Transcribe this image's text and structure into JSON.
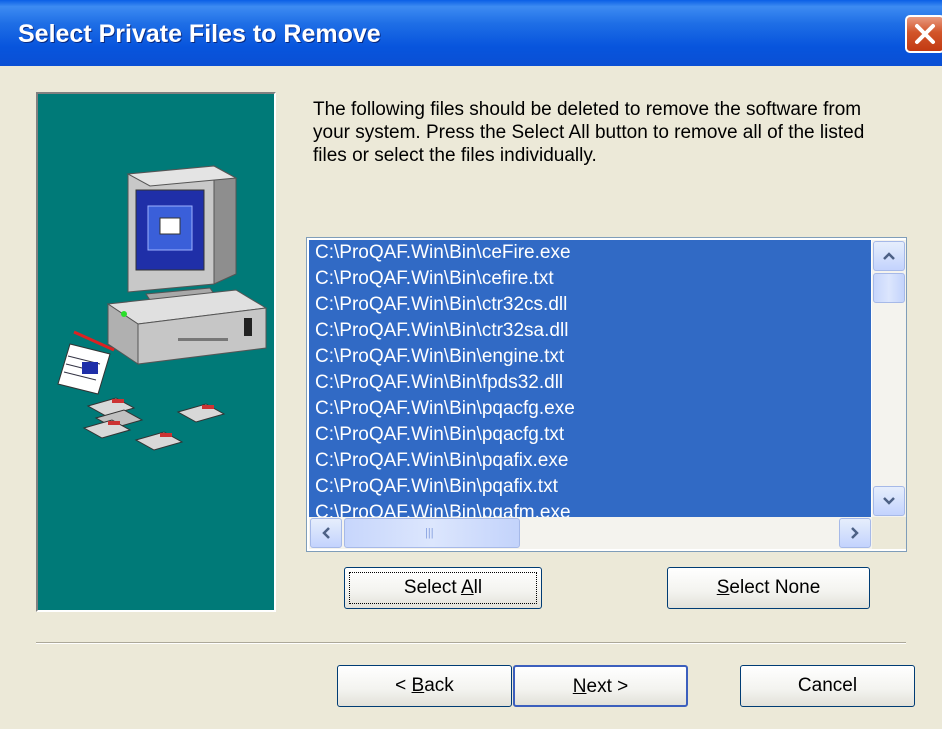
{
  "window": {
    "title": "Select Private Files to Remove"
  },
  "instructions": "The following files should be deleted to remove the software from your system.  Press the Select All button to remove all of the listed files or select the files individually.",
  "file_list": {
    "items": [
      "C:\\ProQAF.Win\\Bin\\ceFire.exe",
      "C:\\ProQAF.Win\\Bin\\cefire.txt",
      "C:\\ProQAF.Win\\Bin\\ctr32cs.dll",
      "C:\\ProQAF.Win\\Bin\\ctr32sa.dll",
      "C:\\ProQAF.Win\\Bin\\engine.txt",
      "C:\\ProQAF.Win\\Bin\\fpds32.dll",
      "C:\\ProQAF.Win\\Bin\\pqacfg.exe",
      "C:\\ProQAF.Win\\Bin\\pqacfg.txt",
      "C:\\ProQAF.Win\\Bin\\pqafix.exe",
      "C:\\ProQAF.Win\\Bin\\pqafix.txt",
      "C:\\ProQAF.Win\\Bin\\pqafm.exe"
    ],
    "selected_color": "#316ac5"
  },
  "buttons": {
    "select_all": {
      "prefix": "Select ",
      "mnemonic": "A",
      "suffix": "ll"
    },
    "select_none": {
      "prefix": "",
      "mnemonic": "S",
      "suffix": "elect None"
    },
    "back": {
      "prefix": "< ",
      "mnemonic": "B",
      "suffix": "ack"
    },
    "next": {
      "prefix": "",
      "mnemonic": "N",
      "suffix": "ext >"
    },
    "cancel": "Cancel"
  },
  "icons": {
    "close": "close-icon",
    "scroll_up": "scroll-up-arrow-icon",
    "scroll_down": "scroll-down-arrow-icon",
    "scroll_left": "scroll-left-arrow-icon",
    "scroll_right": "scroll-right-arrow-icon",
    "illustration": "computer-illustration"
  },
  "colors": {
    "titlebar": "#0a5fe6",
    "panel": "#007a78",
    "dialog": "#ece9d8"
  }
}
